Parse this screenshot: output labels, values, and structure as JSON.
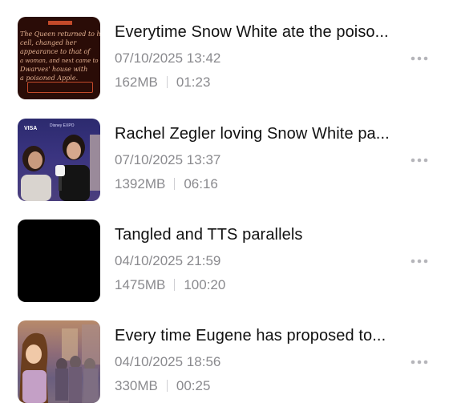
{
  "items": [
    {
      "title": "Everytime Snow White ate the poiso...",
      "date": "07/10/2025 13:42",
      "size": "162MB",
      "duration": "01:23",
      "thumb_text": [
        "The Queen returned to her",
        "cell, changed her",
        "appearance to that of",
        "a woman, and next came to the",
        "Dwarves' house with",
        "a poisoned Apple."
      ]
    },
    {
      "title": "Rachel Zegler loving Snow White pa...",
      "date": "07/10/2025 13:37",
      "size": "1392MB",
      "duration": "06:16",
      "thumb_text": [
        "VISA",
        "Disney EXPO"
      ]
    },
    {
      "title": "Tangled and TTS parallels",
      "date": "04/10/2025 21:59",
      "size": "1475MB",
      "duration": "100:20"
    },
    {
      "title": "Every time Eugene has proposed to...",
      "date": "04/10/2025 18:56",
      "size": "330MB",
      "duration": "00:25"
    }
  ],
  "icons": {
    "more": "more-horizontal-icon"
  },
  "colors": {
    "title": "#111111",
    "secondary": "#8a8a8e",
    "more_dots": "#b5b5ba"
  }
}
